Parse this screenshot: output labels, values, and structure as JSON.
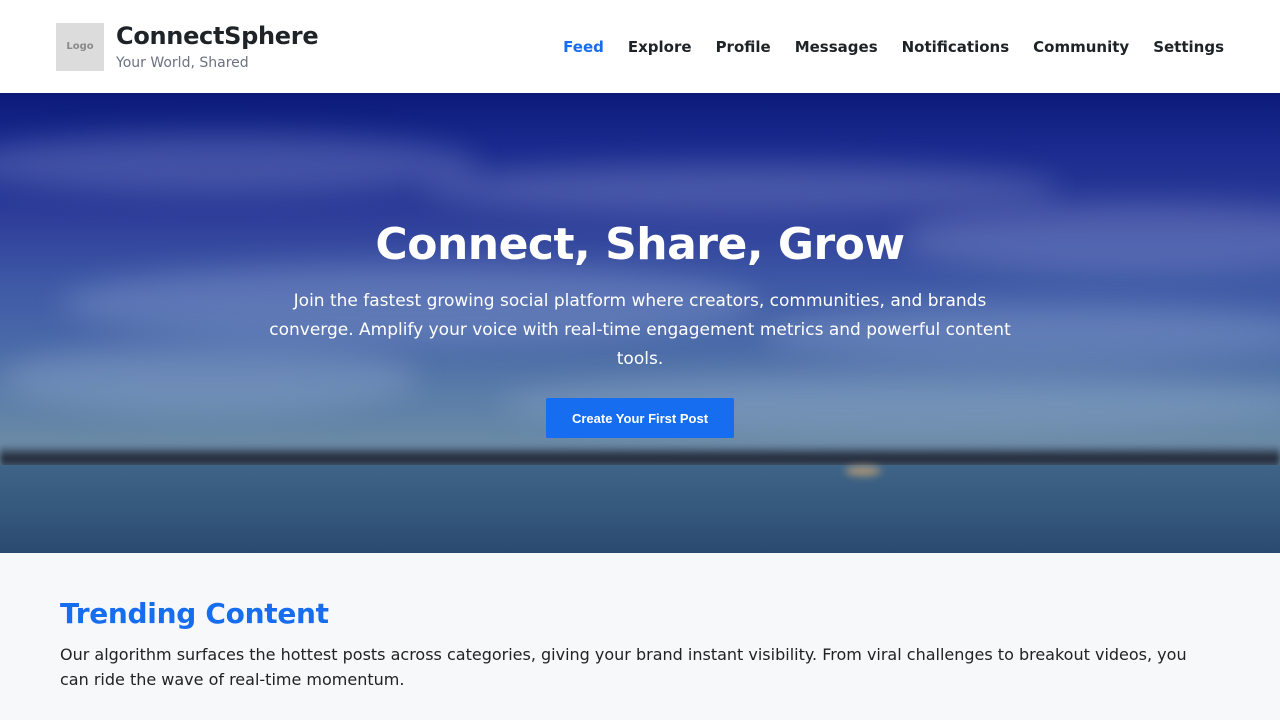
{
  "header": {
    "logo_text": "Logo",
    "brand_name": "ConnectSphere",
    "tagline": "Your World, Shared"
  },
  "nav": {
    "items": [
      {
        "label": "Feed",
        "active": true
      },
      {
        "label": "Explore",
        "active": false
      },
      {
        "label": "Profile",
        "active": false
      },
      {
        "label": "Messages",
        "active": false
      },
      {
        "label": "Notifications",
        "active": false
      },
      {
        "label": "Community",
        "active": false
      },
      {
        "label": "Settings",
        "active": false
      }
    ]
  },
  "hero": {
    "title": "Connect, Share, Grow",
    "text": "Join the fastest growing social platform where creators, communities, and brands converge. Amplify your voice with real-time engagement metrics and powerful content tools.",
    "cta_label": "Create Your First Post"
  },
  "trending": {
    "title": "Trending Content",
    "text": "Our algorithm surfaces the hottest posts across categories, giving your brand instant visibility. From viral challenges to breakout videos, you can ride the wave of real-time momentum."
  },
  "colors": {
    "accent": "#166df0",
    "header_bg": "#ffffff",
    "section_bg": "#f6f8fa"
  }
}
